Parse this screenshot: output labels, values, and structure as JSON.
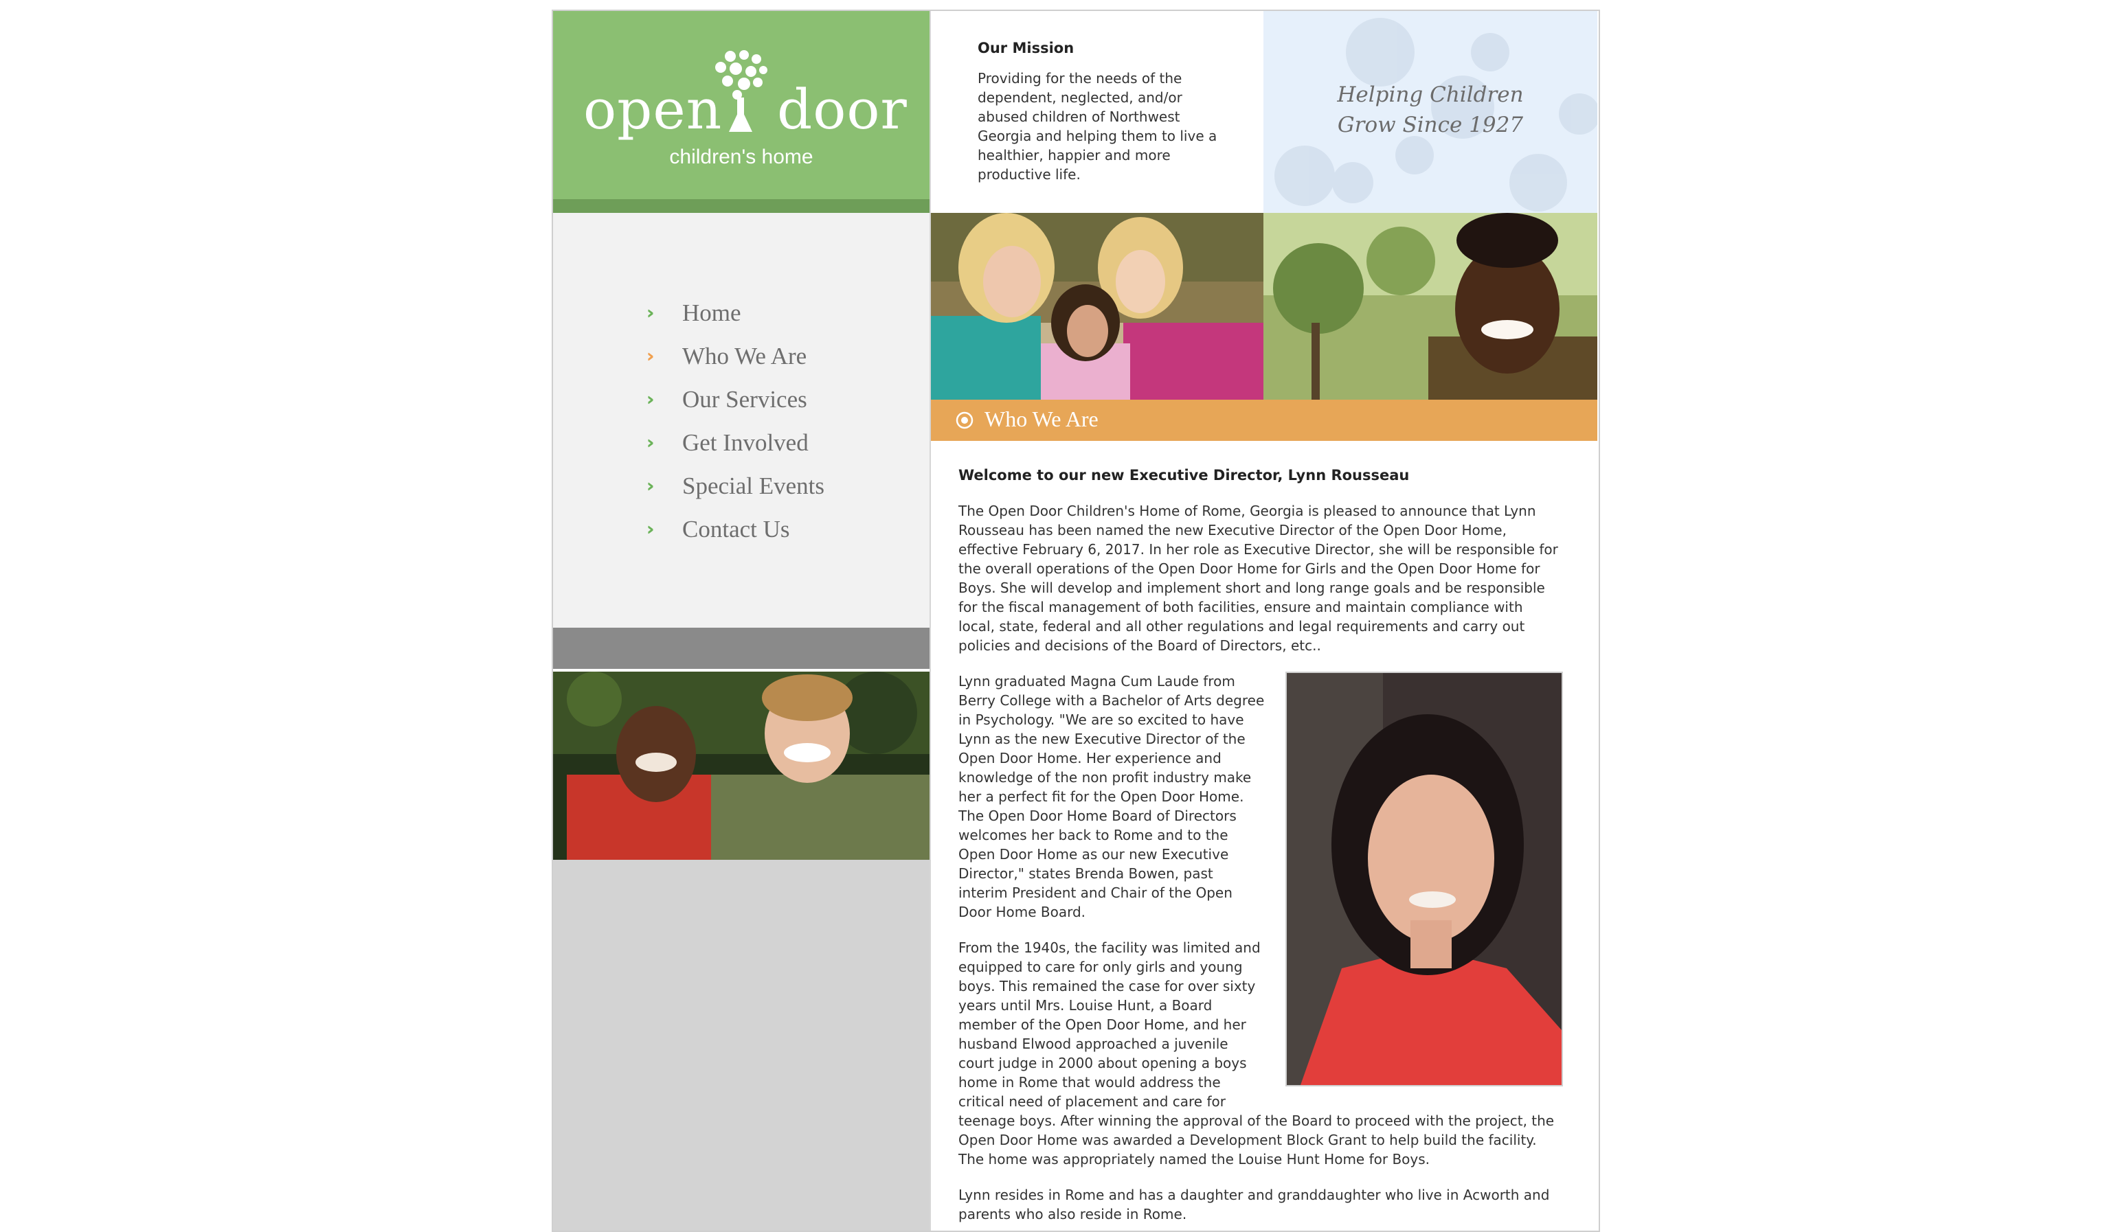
{
  "logo": {
    "word_left": "open",
    "word_right": "door",
    "subtitle": "children's home",
    "icon": "tree-figure-icon"
  },
  "nav": {
    "arrow_icon": "double-chevron-right-icon",
    "items": [
      {
        "label": "Home",
        "active": false
      },
      {
        "label": "Who We Are",
        "active": true
      },
      {
        "label": "Our Services",
        "active": false
      },
      {
        "label": "Get Involved",
        "active": false
      },
      {
        "label": "Special Events",
        "active": false
      },
      {
        "label": "Contact Us",
        "active": false
      }
    ]
  },
  "mission": {
    "title": "Our Mission",
    "text": "Providing for the needs of the dependent, neglected, and/or abused children of Northwest Georgia and helping them to live a healthier, happier and more productive life."
  },
  "tagline": {
    "line1": "Helping Children",
    "line2": "Grow Since 1927"
  },
  "section": {
    "label": "Who We Are",
    "icon": "circle-dot-icon"
  },
  "article": {
    "title": "Welcome to our new Executive Director, Lynn Rousseau",
    "paragraphs": [
      "The Open Door Children's Home of Rome, Georgia is pleased to announce that Lynn Rousseau has been named the new Executive Director of the Open Door Home, effective February 6, 2017. In her role as Executive Director, she will be responsible for the overall operations of the Open Door Home for Girls and the Open Door Home for Boys. She will develop and implement short and long range goals and be responsible for the fiscal management of both facilities, ensure and maintain compliance with local, state, federal and all other regulations and legal requirements and carry out policies and decisions of the Board of Directors, etc..",
      "Lynn graduated Magna Cum Laude from Berry College with a Bachelor of Arts degree in Psychology. \"We are so excited to have Lynn as the new Executive Director of the Open Door Home. Her experience and knowledge of the non profit industry make her a perfect fit for the Open Door Home. The Open Door Home Board of Directors welcomes her back to Rome and to the Open Door Home as our new Executive Director,\" states Brenda Bowen, past interim President and Chair of the Open Door Home Board.",
      "From the 1940s, the facility was limited and equipped to care for only girls and young boys. This remained the case for over sixty years until Mrs. Louise Hunt, a Board member of the Open Door Home, and her husband Elwood approached a juvenile court judge in 2000 about opening a boys home in Rome that would address the critical need of placement and care for teenage boys. After winning the approval of the Board to proceed with the project, the Open Door Home was awarded a Development Block Grant to help build the facility. The home was appropriately named the Louise Hunt Home for Boys.",
      "Lynn resides in Rome and has a daughter and granddaughter who live in Acworth and parents who also reside in Rome."
    ]
  }
}
